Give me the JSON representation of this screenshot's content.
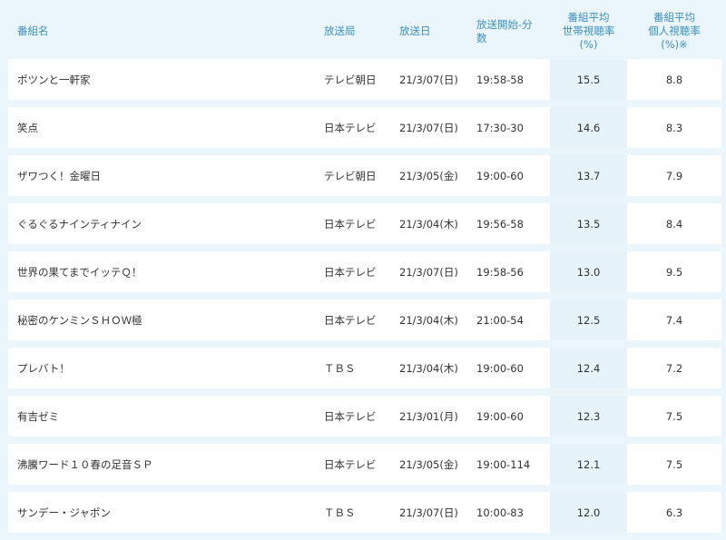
{
  "columns": {
    "program": "番組名",
    "station": "放送局",
    "date": "放送日",
    "start": "放送開始-分数",
    "household": [
      "番組平均",
      "世帯視聴率(%)"
    ],
    "individual": [
      "番組平均",
      "個人視聴率(%)※"
    ]
  },
  "rows": [
    {
      "program": "ポツンと一軒家",
      "station": "テレビ朝日",
      "date": "21/3/07(日)",
      "start": "19:58-58",
      "household": "15.5",
      "individual": "8.8"
    },
    {
      "program": "笑点",
      "station": "日本テレビ",
      "date": "21/3/07(日)",
      "start": "17:30-30",
      "household": "14.6",
      "individual": "8.3"
    },
    {
      "program": "ザワつく！金曜日",
      "station": "テレビ朝日",
      "date": "21/3/05(金)",
      "start": "19:00-60",
      "household": "13.7",
      "individual": "7.9"
    },
    {
      "program": "ぐるぐるナインティナイン",
      "station": "日本テレビ",
      "date": "21/3/04(木)",
      "start": "19:56-58",
      "household": "13.5",
      "individual": "8.4"
    },
    {
      "program": "世界の果てまでイッテＱ！",
      "station": "日本テレビ",
      "date": "21/3/07(日)",
      "start": "19:58-56",
      "household": "13.0",
      "individual": "9.5"
    },
    {
      "program": "秘密のケンミンＳＨＯＷ極",
      "station": "日本テレビ",
      "date": "21/3/04(木)",
      "start": "21:00-54",
      "household": "12.5",
      "individual": "7.4"
    },
    {
      "program": "プレバト！",
      "station": "ＴＢＳ",
      "date": "21/3/04(木)",
      "start": "19:00-60",
      "household": "12.4",
      "individual": "7.2"
    },
    {
      "program": "有吉ゼミ",
      "station": "日本テレビ",
      "date": "21/3/01(月)",
      "start": "19:00-60",
      "household": "12.3",
      "individual": "7.5"
    },
    {
      "program": "沸騰ワード１０春の足音ＳＰ",
      "station": "日本テレビ",
      "date": "21/3/05(金)",
      "start": "19:00-114",
      "household": "12.1",
      "individual": "7.5"
    },
    {
      "program": "サンデー・ジャポン",
      "station": "ＴＢＳ",
      "date": "21/3/07(日)",
      "start": "10:00-83",
      "household": "12.0",
      "individual": "6.3"
    }
  ]
}
